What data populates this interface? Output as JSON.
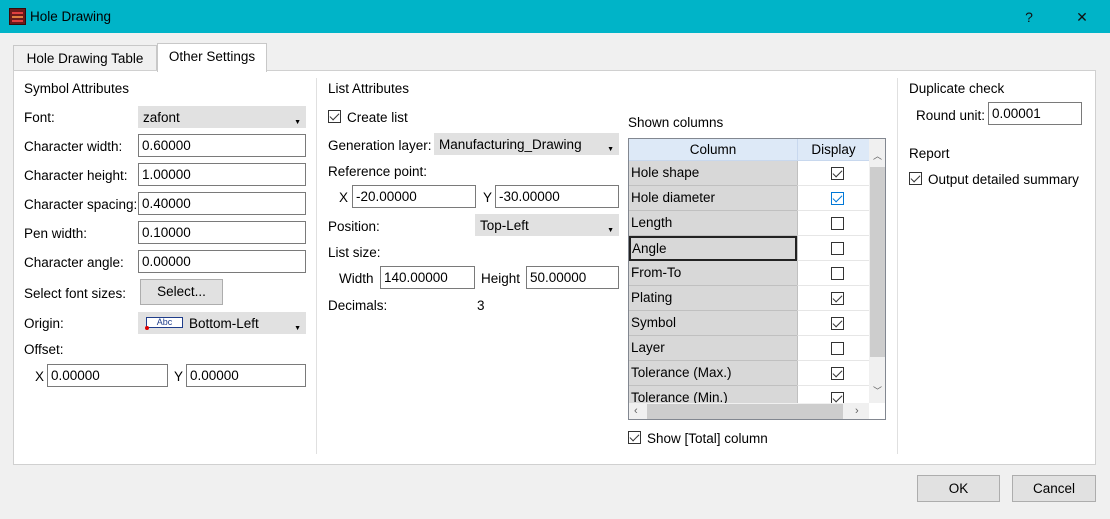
{
  "window": {
    "title": "Hole Drawing",
    "help": "?",
    "close": "✕"
  },
  "tabs": [
    {
      "label": "Hole Drawing Table"
    },
    {
      "label": "Other Settings"
    }
  ],
  "symbol": {
    "section": "Symbol Attributes",
    "font_label": "Font:",
    "font_value": "zafont",
    "char_width_label": "Character width:",
    "char_width": "0.60000",
    "char_height_label": "Character height:",
    "char_height": "1.00000",
    "char_spacing_label": "Character spacing:",
    "char_spacing": "0.40000",
    "pen_width_label": "Pen width:",
    "pen_width": "0.10000",
    "char_angle_label": "Character angle:",
    "char_angle": "0.00000",
    "font_sizes_label": "Select font sizes:",
    "select_button": "Select...",
    "origin_label": "Origin:",
    "origin_icon_text": "Abc",
    "origin_value": "Bottom-Left",
    "offset_label": "Offset:",
    "x_label": "X",
    "x_value": "0.00000",
    "y_label": "Y",
    "y_value": "0.00000"
  },
  "list": {
    "section": "List Attributes",
    "create_list": "Create list",
    "create_list_checked": true,
    "gen_layer_label": "Generation layer:",
    "gen_layer_value": "Manufacturing_Drawing",
    "ref_point_label": "Reference point:",
    "x_label": "X",
    "x_value": "-20.00000",
    "y_label": "Y",
    "y_value": "-30.00000",
    "position_label": "Position:",
    "position_value": "Top-Left",
    "list_size_label": "List size:",
    "width_label": "Width",
    "width_value": "140.00000",
    "height_label": "Height",
    "height_value": "50.00000",
    "decimals_label": "Decimals:",
    "decimals_value": "3"
  },
  "columns": {
    "label": "Shown columns",
    "header_column": "Column",
    "header_display": "Display",
    "rows": [
      {
        "name": "Hole shape",
        "checked": true
      },
      {
        "name": "Hole diameter",
        "checked": true
      },
      {
        "name": "Length",
        "checked": false
      },
      {
        "name": "Angle",
        "checked": false
      },
      {
        "name": "From-To",
        "checked": false
      },
      {
        "name": "Plating",
        "checked": true
      },
      {
        "name": "Symbol",
        "checked": true
      },
      {
        "name": "Layer",
        "checked": false
      },
      {
        "name": "Tolerance  (Max.)",
        "checked": true
      },
      {
        "name": "Tolerance  (Min.)",
        "checked": true
      }
    ],
    "show_total": "Show [Total] column",
    "show_total_checked": true
  },
  "duplicate": {
    "section": "Duplicate check",
    "round_label": "Round unit:",
    "round_value": "0.00001"
  },
  "report": {
    "section": "Report",
    "detailed": "Output detailed summary",
    "detailed_checked": true
  },
  "buttons": {
    "ok": "OK",
    "cancel": "Cancel"
  }
}
